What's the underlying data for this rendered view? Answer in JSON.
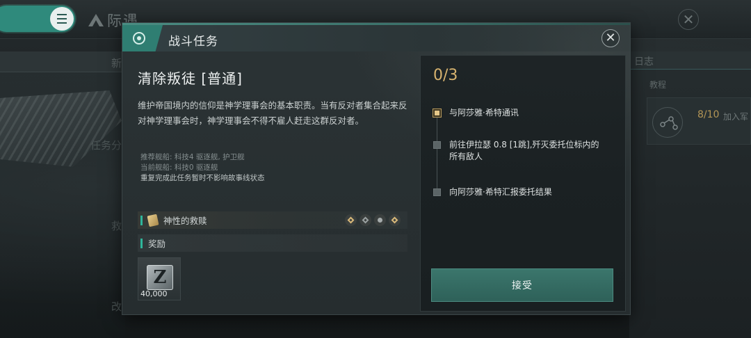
{
  "background": {
    "app_title": "际遇",
    "left_tab": "新",
    "left_labels": [
      "任务分",
      "救",
      "改"
    ],
    "right_tab": "日志",
    "right_section": "教程",
    "right_progress": "8/10",
    "right_progress_label": "加入军"
  },
  "modal": {
    "header_title": "战斗任务",
    "close_glyph": "✕",
    "mission_name": "清除叛徒 [普通]",
    "description": "维护帝国境内的信仰是神学理事会的基本职责。当有反对者集合起来反对神学理事会时，神学理事会不得不雇人赶走这群反对者。",
    "recommended_ships": "推荐舰船: 科技4 驱逐舰, 护卫舰",
    "current_ships": "当前舰船: 科技0 驱逐舰",
    "repeat_note": "重复完成此任务暂时不影响故事线状态",
    "storyline_label": "神性的救赎",
    "reward_label": "奖励",
    "reward_item": {
      "glyph": "Z",
      "count": "40,000"
    }
  },
  "progress": {
    "count": "0/3",
    "steps": [
      {
        "text": "与阿莎雅·希特通讯",
        "active": true
      },
      {
        "text": "前往伊拉瑟 0.8 [1跳],歼灭委托位标内的所有敌人",
        "active": false
      },
      {
        "text": "向阿莎雅·希特汇报委托结果",
        "active": false
      }
    ],
    "accept_label": "接受"
  },
  "colors": {
    "accent_teal": "#2f8a7c",
    "progress_gold": "#d7b36f",
    "button_teal": "#3b766c"
  }
}
